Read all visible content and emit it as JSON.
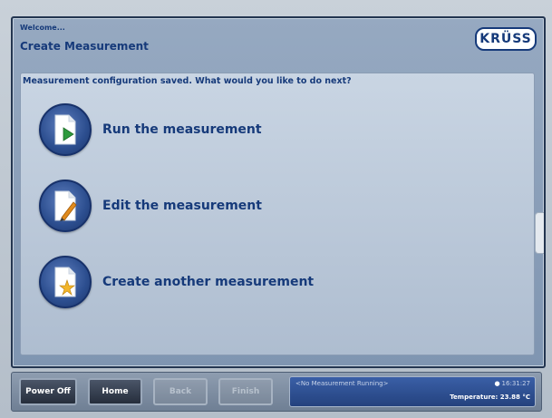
{
  "header": {
    "welcome": "Welcome...",
    "title": "Create Measurement",
    "logo_text": "KRÜSS"
  },
  "content": {
    "prompt": "Measurement configuration saved. What would you like to do next?",
    "options": [
      {
        "label": "Run the measurement",
        "icon": "document-play-icon"
      },
      {
        "label": "Edit the measurement",
        "icon": "document-edit-icon"
      },
      {
        "label": "Create another measurement",
        "icon": "document-new-icon"
      }
    ]
  },
  "footer": {
    "buttons": [
      {
        "label": "Power Off",
        "state": "active"
      },
      {
        "label": "Home",
        "state": "active"
      },
      {
        "label": "Back",
        "state": "disabled"
      },
      {
        "label": "Finish",
        "state": "disabled"
      }
    ],
    "status": {
      "message": "<No Measurement Running>",
      "time": "16:31:27",
      "temperature": "Temperature: 23.88 °C"
    }
  },
  "colors": {
    "primary_text": "#163a7a",
    "screen_bg": "#8a9fb9",
    "status_panel": "#2f4f92",
    "play_green": "#2e9a3c",
    "pencil_orange": "#e08a1c",
    "star_yellow": "#f2b52a"
  }
}
